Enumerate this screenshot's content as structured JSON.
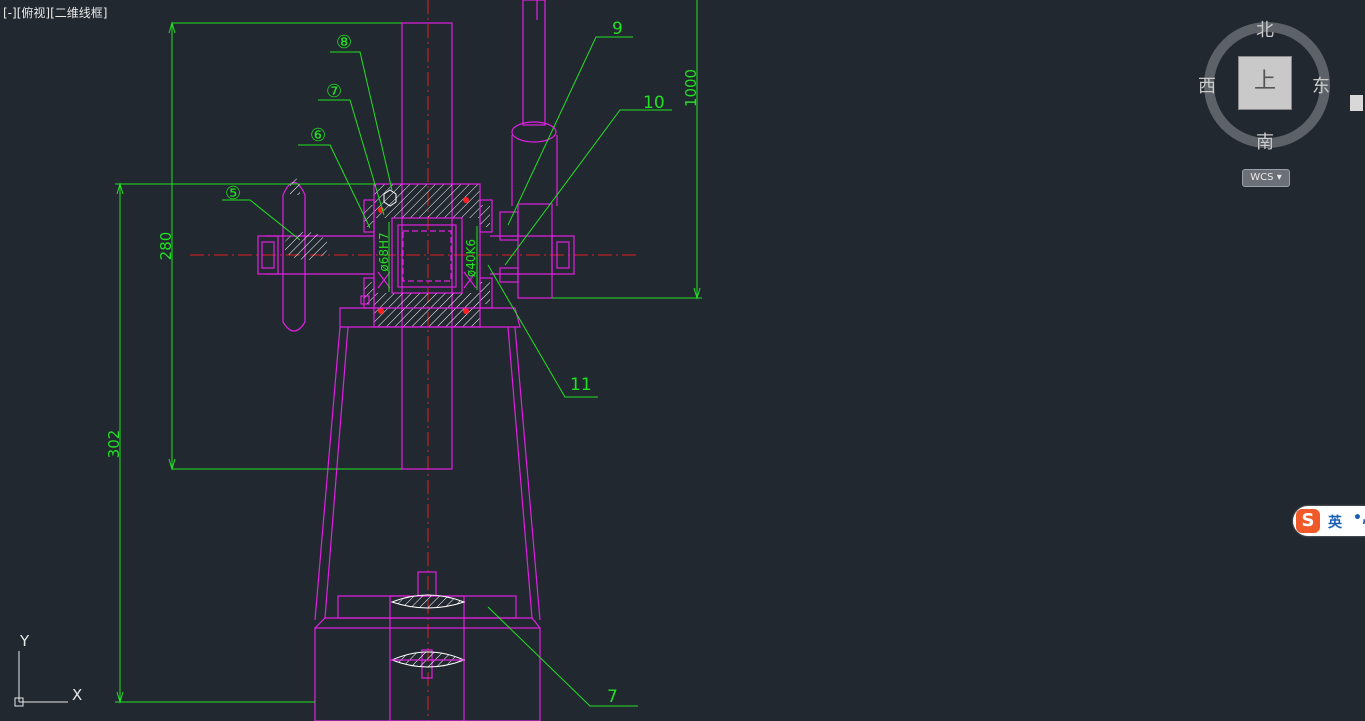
{
  "viewport": {
    "control": "[-]",
    "view": "[俯视]",
    "visual_style": "[二维线框]"
  },
  "viewcube": {
    "face": "上",
    "north": "北",
    "south": "南",
    "east": "东",
    "west": "西",
    "wcs": "WCS"
  },
  "drawing": {
    "callouts": {
      "c5": "⑤",
      "c6": "⑥",
      "c7": "⑦",
      "c8": "⑧",
      "n9": "9",
      "n10": "10",
      "n11": "11",
      "n7": "7"
    },
    "dimensions": {
      "d280": "280",
      "d302": "302",
      "d1000": "1000",
      "fit_hole": "ø68H7",
      "fit_shaft": "ø40K6"
    }
  },
  "ucs": {
    "x": "X",
    "y": "Y"
  },
  "ime": {
    "logo": "S",
    "mode": "英"
  },
  "colors": {
    "background": "#212830",
    "geometry": "#e020e0",
    "dimension": "#22e022",
    "centerline": "#e02020"
  }
}
